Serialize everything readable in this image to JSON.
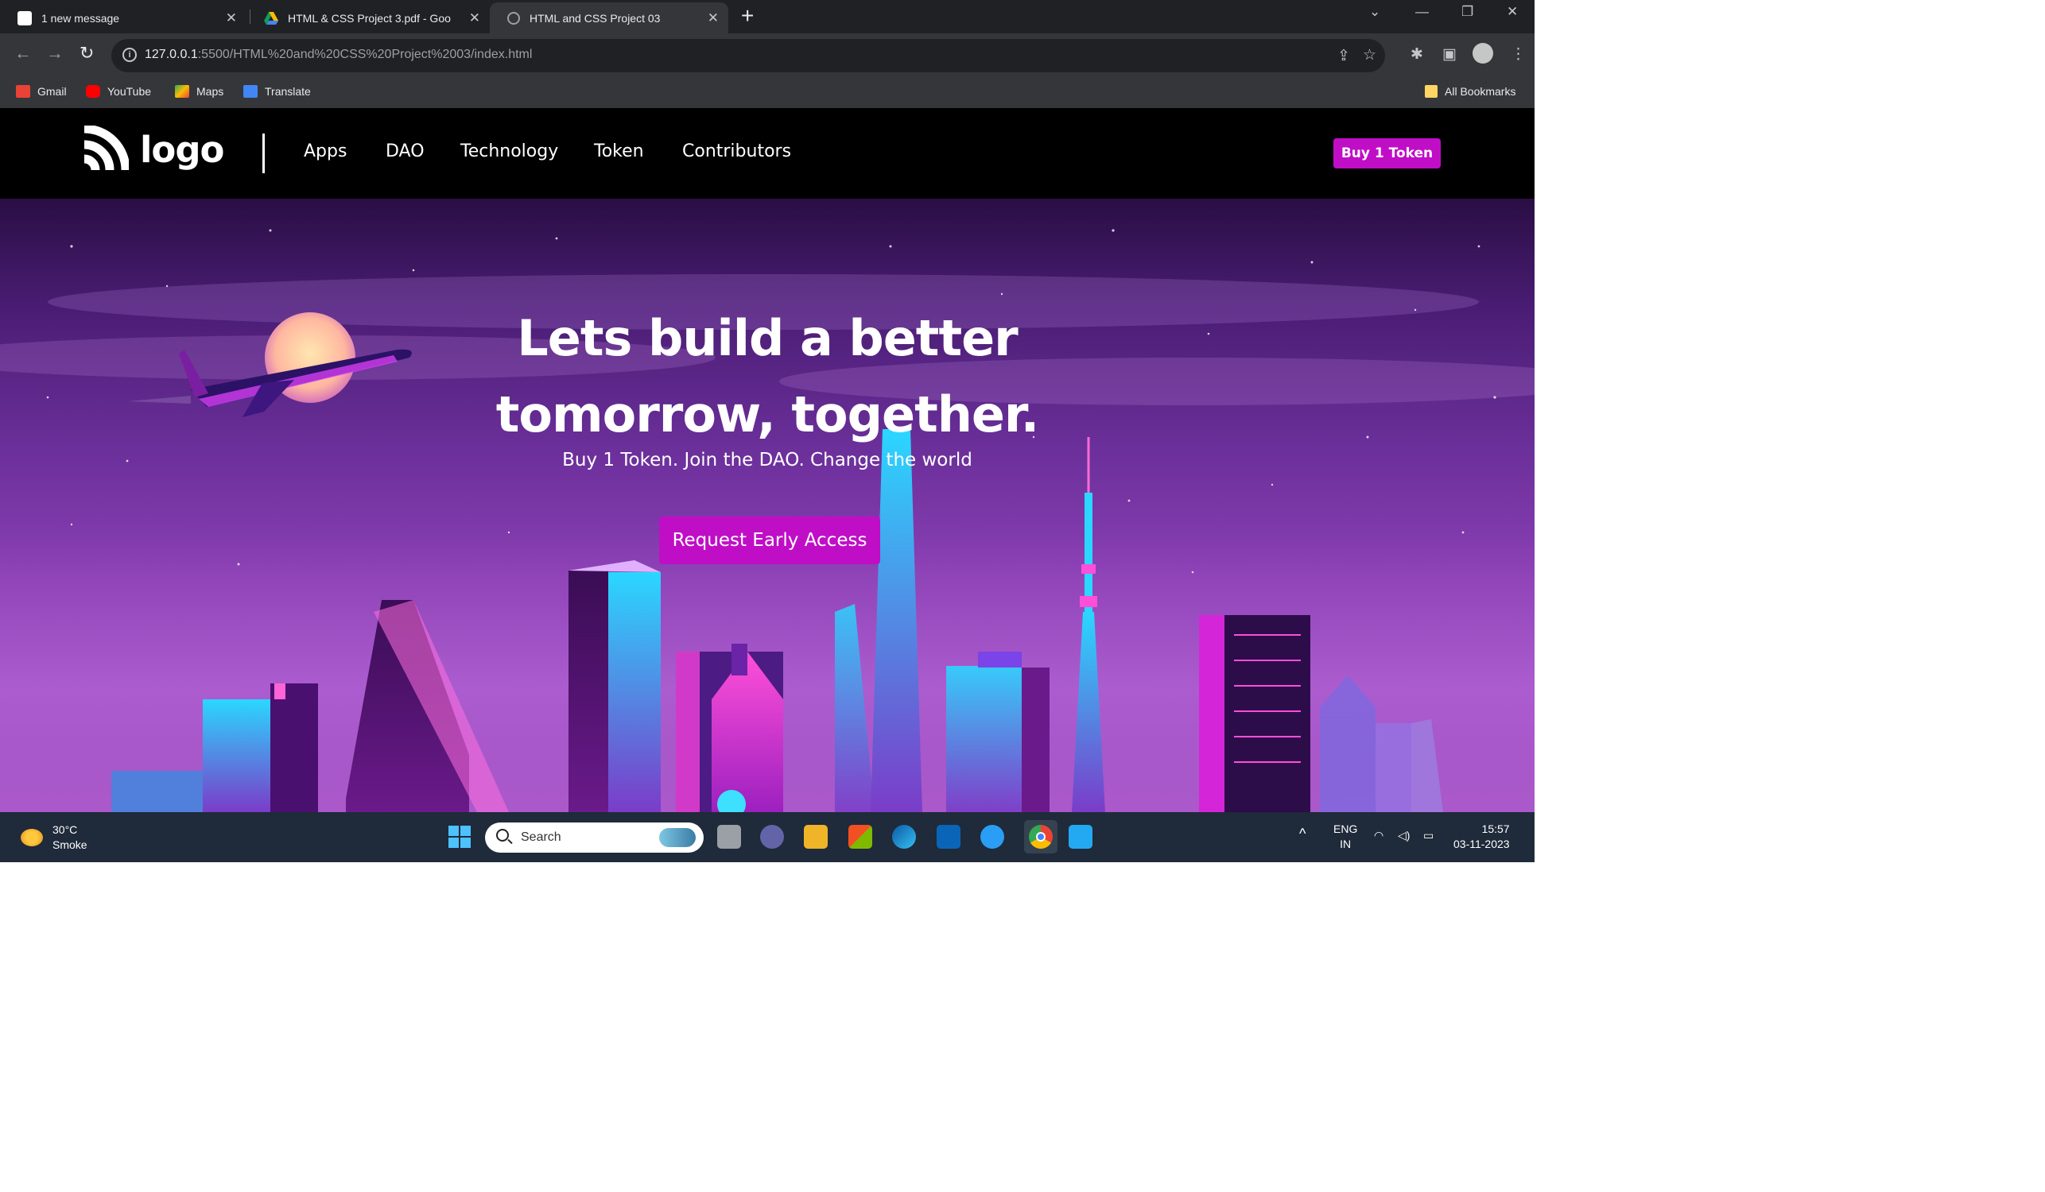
{
  "browser": {
    "tabs": [
      {
        "title": "1 new message",
        "active": false,
        "icon": "notion-icon"
      },
      {
        "title": "HTML & CSS Project 3.pdf - Goo",
        "active": false,
        "icon": "google-drive-icon"
      },
      {
        "title": "HTML and CSS Project 03",
        "active": true,
        "icon": "globe-icon"
      }
    ],
    "url_host": "127.0.0.1",
    "url_path": ":5500/HTML%20and%20CSS%20Project%2003/index.html",
    "bookmarks": [
      {
        "label": "Gmail",
        "color": "#ea4335"
      },
      {
        "label": "YouTube",
        "color": "#ff0000"
      },
      {
        "label": "Maps",
        "color": "#34a853"
      },
      {
        "label": "Translate",
        "color": "#4285f4"
      }
    ],
    "all_bookmarks": "All Bookmarks"
  },
  "site": {
    "logo_text": "logo",
    "nav": [
      "Apps",
      "DAO",
      "Technology",
      "Token",
      "Contributors"
    ],
    "buy_button": "Buy 1 Token",
    "hero": {
      "title_line1": "Lets build a better",
      "title_line2": "tomorrow, together.",
      "subtitle": "Buy 1 Token. Join the DAO. Change the world",
      "cta": "Request Early Access"
    },
    "accent_color": "#c00ec7"
  },
  "taskbar": {
    "temperature": "30°C",
    "weather": "Smoke",
    "search_placeholder": "Search",
    "lang_line1": "ENG",
    "lang_line2": "IN",
    "time": "15:57",
    "date": "03-11-2023"
  }
}
